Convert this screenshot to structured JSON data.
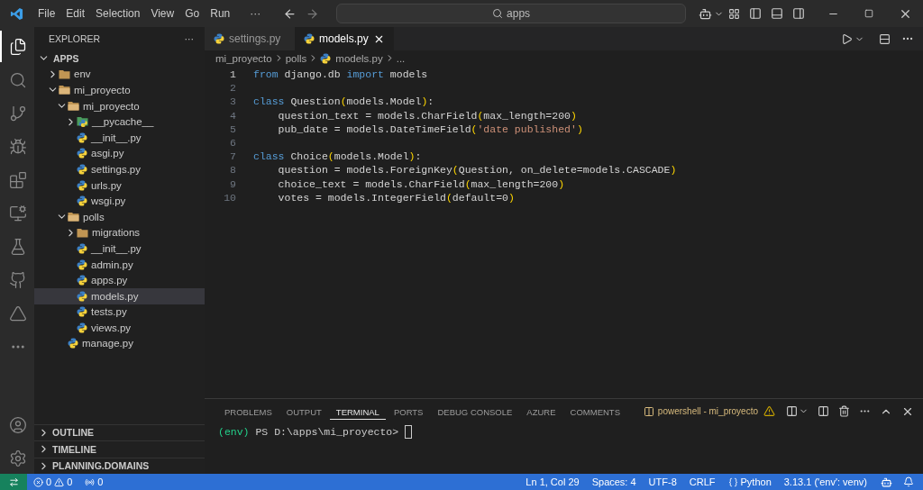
{
  "menu": [
    "File",
    "Edit",
    "Selection",
    "View",
    "Go",
    "Run"
  ],
  "menu_more": "···",
  "search": {
    "value": "apps"
  },
  "activity_bar": [
    {
      "selected": true
    },
    {
      "selected": false
    },
    {
      "selected": false
    },
    {
      "selected": false
    },
    {
      "selected": false
    },
    {
      "selected": false
    },
    {
      "selected": false
    },
    {
      "selected": false
    },
    {
      "selected": false
    }
  ],
  "sidebar": {
    "title": "EXPLORER",
    "more": "···",
    "tree": [
      {
        "label": "APPS",
        "kind": "root",
        "expanded": true,
        "selected": false,
        "children": [
          {
            "label": "env",
            "kind": "folder",
            "expanded": false,
            "selected": false
          },
          {
            "label": "mi_proyecto",
            "kind": "folder",
            "expanded": true,
            "selected": false,
            "children": [
              {
                "label": "mi_proyecto",
                "kind": "folder",
                "expanded": true,
                "selected": false,
                "children": [
                  {
                    "label": "__pycache__",
                    "kind": "pyfolder",
                    "expanded": false,
                    "selected": false
                  },
                  {
                    "label": "__init__.py",
                    "kind": "python",
                    "selected": false
                  },
                  {
                    "label": "asgi.py",
                    "kind": "python",
                    "selected": false
                  },
                  {
                    "label": "settings.py",
                    "kind": "python",
                    "selected": false
                  },
                  {
                    "label": "urls.py",
                    "kind": "python",
                    "selected": false
                  },
                  {
                    "label": "wsgi.py",
                    "kind": "python",
                    "selected": false
                  }
                ]
              },
              {
                "label": "polls",
                "kind": "folder",
                "expanded": true,
                "selected": false,
                "children": [
                  {
                    "label": "migrations",
                    "kind": "folder",
                    "expanded": false,
                    "selected": false
                  },
                  {
                    "label": "__init__.py",
                    "kind": "python",
                    "selected": false
                  },
                  {
                    "label": "admin.py",
                    "kind": "python",
                    "selected": false
                  },
                  {
                    "label": "apps.py",
                    "kind": "python",
                    "selected": false
                  },
                  {
                    "label": "models.py",
                    "kind": "python",
                    "selected": true
                  },
                  {
                    "label": "tests.py",
                    "kind": "python",
                    "selected": false
                  },
                  {
                    "label": "views.py",
                    "kind": "python",
                    "selected": false
                  }
                ]
              },
              {
                "label": "manage.py",
                "kind": "python",
                "selected": false
              }
            ]
          }
        ]
      }
    ],
    "sections": [
      {
        "label": "OUTLINE",
        "expanded": false
      },
      {
        "label": "TIMELINE",
        "expanded": false
      },
      {
        "label": "PLANNING.DOMAINS",
        "expanded": false
      }
    ]
  },
  "tabs": [
    {
      "label": "settings.py",
      "selected": false
    },
    {
      "label": "models.py",
      "selected": true
    }
  ],
  "breadcrumb": [
    {
      "label": "mi_proyecto",
      "kind": "folder"
    },
    {
      "label": "polls",
      "kind": "folder"
    },
    {
      "label": "models.py",
      "kind": "file"
    },
    {
      "label": "...",
      "kind": "more"
    }
  ],
  "code": [
    {
      "number": "1",
      "current": true,
      "tokens": [
        {
          "kind": "kw",
          "text": "from"
        },
        {
          "kind": "plain",
          "text": " django.db "
        },
        {
          "kind": "kw",
          "text": "import"
        },
        {
          "kind": "plain",
          "text": " models"
        }
      ]
    },
    {
      "number": "2",
      "current": false
    },
    {
      "number": "3",
      "current": false,
      "tokens": [
        {
          "kind": "kw",
          "text": "class"
        },
        {
          "kind": "plain",
          "text": " Question"
        },
        {
          "kind": "paren",
          "text": "("
        },
        {
          "kind": "plain",
          "text": "models.Model"
        },
        {
          "kind": "paren",
          "text": ")"
        },
        {
          "kind": "plain",
          "text": ":"
        }
      ]
    },
    {
      "number": "4",
      "current": false,
      "tokens": [
        {
          "kind": "plain",
          "text": "    question_text = models.CharField"
        },
        {
          "kind": "paren",
          "text": "("
        },
        {
          "kind": "plain",
          "text": "max_length=200"
        },
        {
          "kind": "paren",
          "text": ")"
        }
      ]
    },
    {
      "number": "5",
      "current": false,
      "tokens": [
        {
          "kind": "plain",
          "text": "    pub_date = models.DateTimeField"
        },
        {
          "kind": "paren",
          "text": "("
        },
        {
          "kind": "str",
          "text": "'date published'"
        },
        {
          "kind": "paren",
          "text": ")"
        }
      ]
    },
    {
      "number": "6",
      "current": false
    },
    {
      "number": "7",
      "current": false,
      "tokens": [
        {
          "kind": "kw",
          "text": "class"
        },
        {
          "kind": "plain",
          "text": " Choice"
        },
        {
          "kind": "paren",
          "text": "("
        },
        {
          "kind": "plain",
          "text": "models.Model"
        },
        {
          "kind": "paren",
          "text": ")"
        },
        {
          "kind": "plain",
          "text": ":"
        }
      ]
    },
    {
      "number": "8",
      "current": false,
      "tokens": [
        {
          "kind": "plain",
          "text": "    question = models.ForeignKey"
        },
        {
          "kind": "paren",
          "text": "("
        },
        {
          "kind": "plain",
          "text": "Question, on_delete=models.CASCADE"
        },
        {
          "kind": "paren",
          "text": ")"
        }
      ]
    },
    {
      "number": "9",
      "current": false,
      "tokens": [
        {
          "kind": "plain",
          "text": "    choice_text = models.CharField"
        },
        {
          "kind": "paren",
          "text": "("
        },
        {
          "kind": "plain",
          "text": "max_length=200"
        },
        {
          "kind": "paren",
          "text": ")"
        }
      ]
    },
    {
      "number": "10",
      "current": false,
      "tokens": [
        {
          "kind": "plain",
          "text": "    votes = models.IntegerField"
        },
        {
          "kind": "paren",
          "text": "("
        },
        {
          "kind": "plain",
          "text": "default=0"
        },
        {
          "kind": "paren",
          "text": ")"
        }
      ]
    }
  ],
  "panel": {
    "tabs": [
      {
        "label": "PROBLEMS",
        "selected": false
      },
      {
        "label": "OUTPUT",
        "selected": false
      },
      {
        "label": "TERMINAL",
        "selected": true
      },
      {
        "label": "PORTS",
        "selected": false
      },
      {
        "label": "DEBUG CONSOLE",
        "selected": false
      },
      {
        "label": "AZURE",
        "selected": false
      },
      {
        "label": "COMMENTS",
        "selected": false
      }
    ],
    "terminal_name": "powershell - mi_proyecto",
    "prompt_env": "(env)",
    "prompt": "PS D:\\apps\\mi_proyecto>"
  },
  "status_bar": {
    "errors": "0",
    "warnings": "0",
    "ports": "0",
    "right": [
      "Ln 1, Col 29",
      "Spaces: 4",
      "UTF-8",
      "CRLF"
    ],
    "language": "Python",
    "interpreter": "3.13.1 ('env': venv)"
  }
}
